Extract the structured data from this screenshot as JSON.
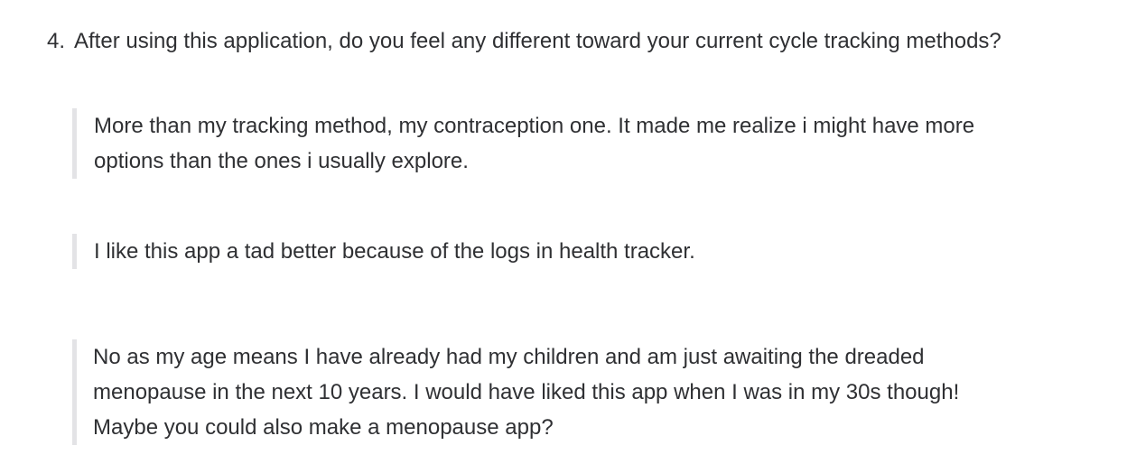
{
  "question": {
    "number": "4.",
    "text": "After using this application, do you feel any different toward your current cycle tracking methods?"
  },
  "responses": [
    {
      "text": "More than my tracking method, my contraception one. It made me realize i might have more options than the ones i usually explore."
    },
    {
      "text": "I like this app a tad better because of the logs in health tracker."
    },
    {
      "text": "No as my age means I have already had my children and am just awaiting the dreaded menopause in the next 10 years. I would have liked this app when I was in my 30s though! Maybe you could also make a menopause app?"
    }
  ]
}
